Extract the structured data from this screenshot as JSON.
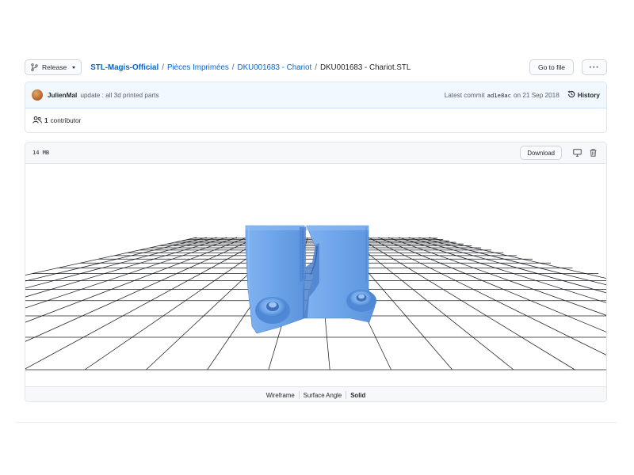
{
  "header": {
    "branch_label": "Release",
    "breadcrumb": {
      "root": "STL-Magis-Official",
      "dir1": "Pièces Imprimées",
      "dir2": "DKU001683 - Chariot",
      "file": "DKU001683 - Chariot.STL",
      "separator": "/"
    },
    "goto_file_label": "Go to file",
    "more_label": "···"
  },
  "commit": {
    "author": "JulienMal",
    "message": "update : all 3d printed parts",
    "latest_label": "Latest commit",
    "sha": "ad1e8ac",
    "date": "on 21 Sep 2018",
    "history_label": "History"
  },
  "contributors": {
    "count": "1",
    "label": "contributor"
  },
  "file": {
    "size": "14 MB",
    "download_label": "Download",
    "display_modes": [
      "Wireframe",
      "Surface Angle",
      "Solid"
    ],
    "active_mode": "Solid"
  },
  "colors": {
    "link": "#0366d6",
    "model_blue": "#6fa6ea",
    "commit_bg": "#f1f8ff",
    "header_bg": "#f6f8fa"
  },
  "icons": {
    "branch": "git-branch-icon",
    "history": "history-icon",
    "people": "people-icon",
    "desktop": "desktop-icon",
    "trash": "trash-icon"
  }
}
